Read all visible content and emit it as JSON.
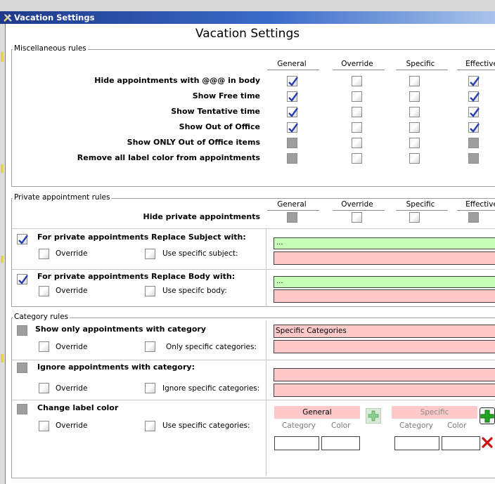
{
  "window": {
    "title": "Vacation Settings",
    "heading": "Vacation Settings"
  },
  "columns": [
    "General",
    "Override",
    "Specific",
    "Effective"
  ],
  "misc": {
    "legend": "Miscellaneous rules",
    "rows": [
      {
        "label": "Hide appointments with @@@ in body",
        "general": "checked",
        "override": "unchecked",
        "specific": "unchecked",
        "effective": "checked"
      },
      {
        "label": "Show Free time",
        "general": "checked",
        "override": "unchecked",
        "specific": "unchecked",
        "effective": "checked"
      },
      {
        "label": "Show Tentative time",
        "general": "checked",
        "override": "unchecked",
        "specific": "unchecked",
        "effective": "checked"
      },
      {
        "label": "Show Out of Office",
        "general": "checked",
        "override": "unchecked",
        "specific": "unchecked",
        "effective": "checked"
      },
      {
        "label": "Show ONLY Out of Office items",
        "general": "disabled",
        "override": "unchecked",
        "specific": "unchecked",
        "effective": "disabled"
      },
      {
        "label": "Remove all label color from appointments",
        "general": "disabled",
        "override": "unchecked",
        "specific": "unchecked",
        "effective": "disabled"
      }
    ]
  },
  "private": {
    "legend": "Private appointment rules",
    "hide_label": "Hide private appointments",
    "subject": {
      "label": "For private appointments Replace Subject with:",
      "override": "Override",
      "specific": "Use specific subject:",
      "general_value": "...",
      "specific_value": ""
    },
    "body": {
      "label": "For private appointments Replace Body with:",
      "override": "Override",
      "specific": "Use specifc body:",
      "general_value": "...",
      "specific_value": ""
    }
  },
  "category": {
    "legend": "Category rules",
    "show_only": {
      "label": "Show only appointments with category",
      "override": "Override",
      "specific": "Only specific categories:",
      "value": "Specific Categories"
    },
    "ignore": {
      "label": "Ignore appointments with category:",
      "override": "Override",
      "specific": "Ignore specific categories:"
    },
    "change_color": {
      "label": "Change label color",
      "override": "Override",
      "specific": "Use specific categories:",
      "general_header": "General",
      "specific_header": "Specific",
      "category_col": "Category",
      "color_col": "Color"
    }
  },
  "colors": {
    "title_start": "#1e3a8a",
    "title_end": "#a9c3ea",
    "green_field": "#c8ffb8",
    "pink_field": "#ffc9c9",
    "check_blue": "#2a3fb0"
  }
}
